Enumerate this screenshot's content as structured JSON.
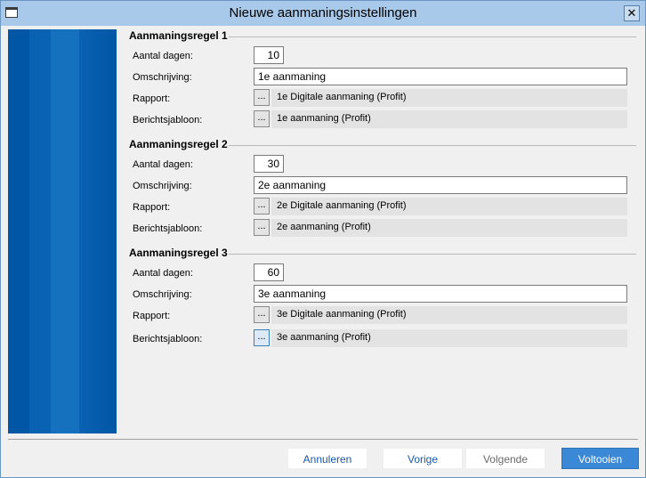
{
  "window": {
    "title": "Nieuwe aanmaningsinstellingen",
    "close_glyph": "✕",
    "app_icon": "window-icon",
    "close_icon": "close-icon"
  },
  "colors": {
    "banner": "#0256a6",
    "titlebar": "#a9c9ea",
    "primary_button": "#3a88d6"
  },
  "labels": {
    "aantal_dagen": "Aantal dagen:",
    "omschrijving": "Omschrijving:",
    "rapport": "Rapport:",
    "berichtsjabloon": "Berichtsjabloon:",
    "browse": "..."
  },
  "rules": [
    {
      "title": "Aanmaningsregel 1",
      "dagen": "10",
      "omschrijving": "1e aanmaning",
      "rapport": "1e Digitale aanmaning (Profit)",
      "berichtsjabloon": "1e aanmaning (Profit)"
    },
    {
      "title": "Aanmaningsregel 2",
      "dagen": "30",
      "omschrijving": "2e aanmaning",
      "rapport": "2e Digitale aanmaning (Profit)",
      "berichtsjabloon": "2e aanmaning (Profit)"
    },
    {
      "title": "Aanmaningsregel 3",
      "dagen": "60",
      "omschrijving": "3e aanmaning",
      "rapport": "3e Digitale aanmaning (Profit)",
      "berichtsjabloon": "3e aanmaning (Profit)"
    }
  ],
  "footer": {
    "annuleren": "Annuleren",
    "vorige": "Vorige",
    "volgende": "Volgende",
    "voltooien": "Voltooien"
  }
}
